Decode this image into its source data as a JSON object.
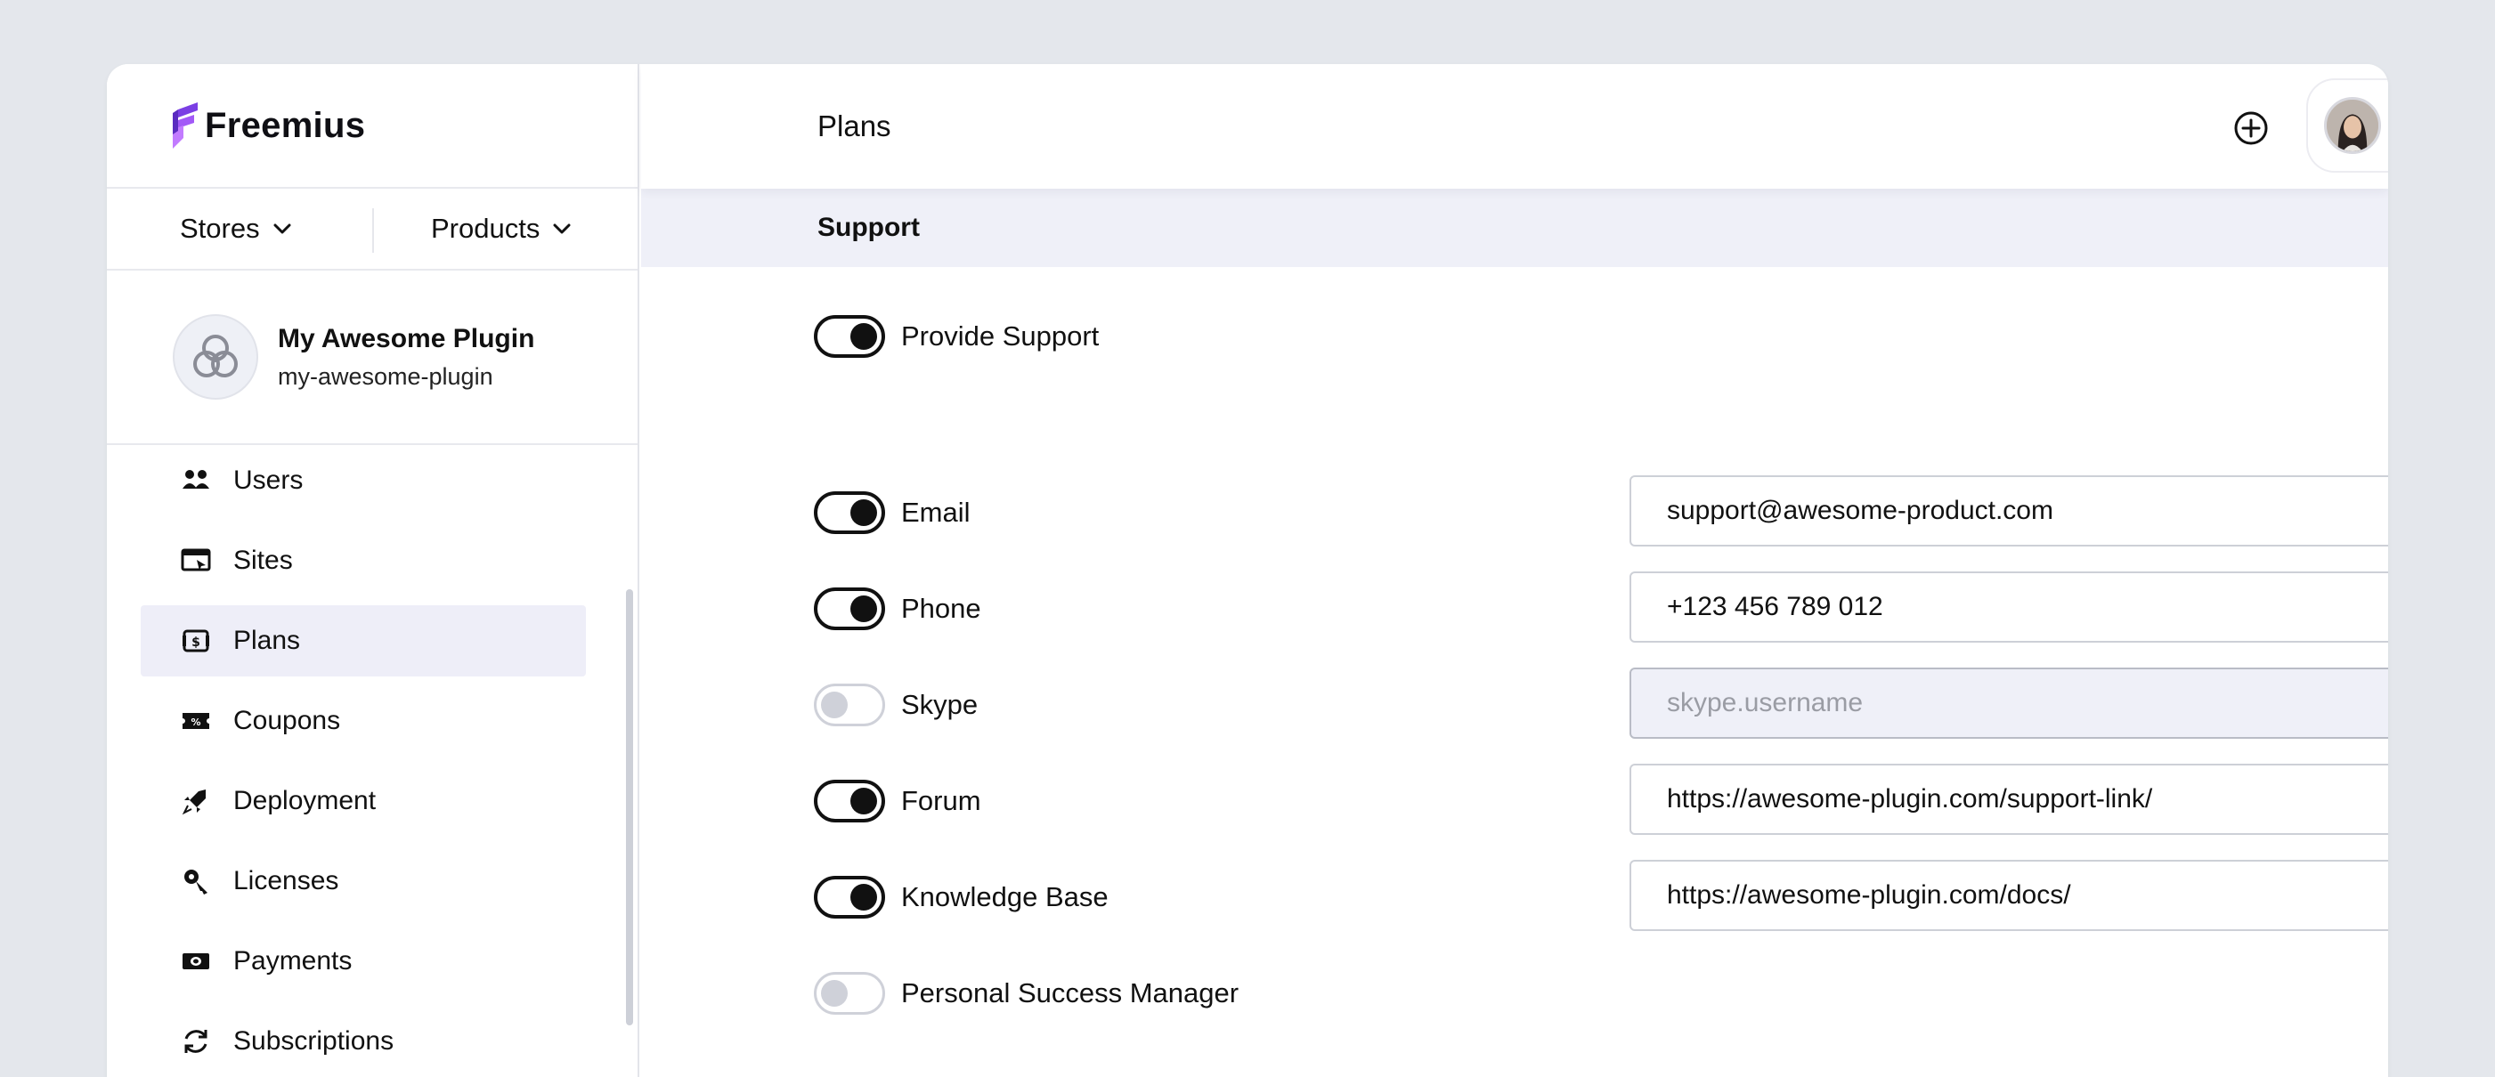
{
  "brand": {
    "name": "Freemius",
    "accent": "#7b3fe4"
  },
  "switcher": {
    "stores_label": "Stores",
    "products_label": "Products"
  },
  "product": {
    "name": "My Awesome Plugin",
    "slug": "my-awesome-plugin"
  },
  "sidebar": {
    "items": [
      {
        "label": "Users",
        "icon": "users-icon",
        "active": false
      },
      {
        "label": "Sites",
        "icon": "sites-icon",
        "active": false
      },
      {
        "label": "Plans",
        "icon": "plans-icon",
        "active": true
      },
      {
        "label": "Coupons",
        "icon": "coupons-icon",
        "active": false
      },
      {
        "label": "Deployment",
        "icon": "deployment-icon",
        "active": false
      },
      {
        "label": "Licenses",
        "icon": "key-icon",
        "active": false
      },
      {
        "label": "Payments",
        "icon": "payments-icon",
        "active": false
      },
      {
        "label": "Subscriptions",
        "icon": "subscriptions-icon",
        "active": false
      }
    ]
  },
  "header": {
    "title": "Plans"
  },
  "section": {
    "title": "Support"
  },
  "support": {
    "provide_support": {
      "label": "Provide Support",
      "enabled": true
    },
    "channels": [
      {
        "key": "email",
        "label": "Email",
        "enabled": true,
        "value": "support@awesome-product.com",
        "placeholder": ""
      },
      {
        "key": "phone",
        "label": "Phone",
        "enabled": true,
        "value": "+123 456 789 012",
        "placeholder": ""
      },
      {
        "key": "skype",
        "label": "Skype",
        "enabled": false,
        "value": "",
        "placeholder": "skype.username"
      },
      {
        "key": "forum",
        "label": "Forum",
        "enabled": true,
        "value": "https://awesome-plugin.com/support-link/",
        "placeholder": ""
      },
      {
        "key": "kb",
        "label": "Knowledge Base",
        "enabled": true,
        "value": "https://awesome-plugin.com/docs/",
        "placeholder": ""
      },
      {
        "key": "psm",
        "label": "Personal Success Manager",
        "enabled": false
      }
    ]
  }
}
